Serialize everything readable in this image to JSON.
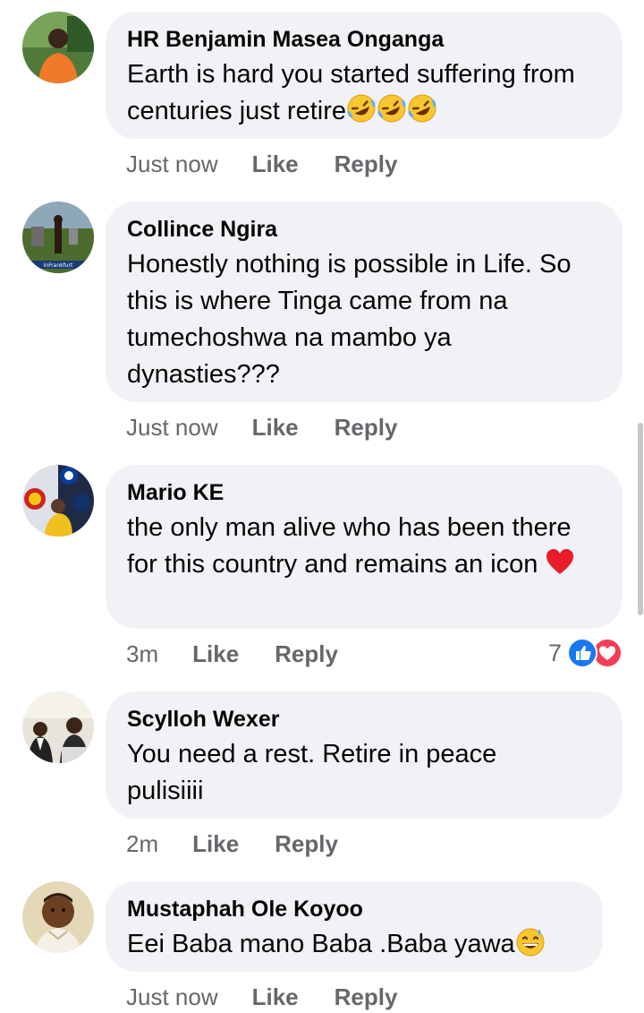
{
  "comments": [
    {
      "author": "HR Benjamin Masea Onganga",
      "text": "Earth is hard you started suffering from centuries just retire",
      "emoji": "rofl-emoji x3",
      "time": "Just now",
      "like": "Like",
      "reply": "Reply"
    },
    {
      "author": "Collince Ngira",
      "text": "Honestly nothing is possible in Life. So this is where Tinga came from na tumechoshwa na mambo ya dynasties???",
      "time": "Just now",
      "like": "Like",
      "reply": "Reply"
    },
    {
      "author": "Mario KE",
      "text": "the only man alive who has been there for this country and remains an icon",
      "emoji": "red-heart-emoji",
      "time": "3m",
      "like": "Like",
      "reply": "Reply",
      "reaction_count": "7",
      "reaction_icons": [
        "like-reaction-icon",
        "love-reaction-icon"
      ]
    },
    {
      "author": "Scylloh Wexer",
      "text": "You need a rest. Retire in peace pulisiiii",
      "time": "2m",
      "like": "Like",
      "reply": "Reply"
    },
    {
      "author": "Mustaphah Ole Koyoo",
      "text": "Eei Baba mano Baba .Baba yawa",
      "emoji": "grinning-sweat-emoji",
      "time": "Just now",
      "like": "Like",
      "reply": "Reply"
    }
  ],
  "colors": {
    "bubble": "#f0f2f5",
    "text": "#050505",
    "secondary": "#65676b",
    "like_blue": "#1877f2",
    "love_red": "#f33e58"
  }
}
